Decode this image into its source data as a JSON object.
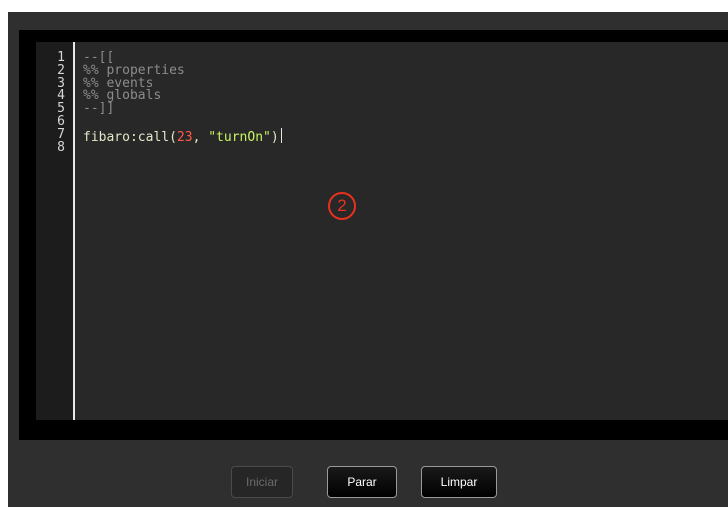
{
  "editor": {
    "lines": [
      {
        "num": "1",
        "tokens": [
          {
            "cls": "comment",
            "text": "--[["
          }
        ]
      },
      {
        "num": "2",
        "tokens": [
          {
            "cls": "comment",
            "text": "%% properties"
          }
        ]
      },
      {
        "num": "3",
        "tokens": [
          {
            "cls": "comment",
            "text": "%% events"
          }
        ]
      },
      {
        "num": "4",
        "tokens": [
          {
            "cls": "comment",
            "text": "%% globals"
          }
        ]
      },
      {
        "num": "5",
        "tokens": [
          {
            "cls": "comment",
            "text": "--]]"
          }
        ]
      },
      {
        "num": "6",
        "tokens": []
      },
      {
        "num": "7",
        "tokens": [
          {
            "cls": "ident",
            "text": "fibaro:call("
          },
          {
            "cls": "num",
            "text": "23"
          },
          {
            "cls": "punct",
            "text": ", "
          },
          {
            "cls": "str",
            "text": "\"turnOn\""
          },
          {
            "cls": "punct",
            "text": ")"
          }
        ]
      },
      {
        "num": "8",
        "tokens": []
      }
    ]
  },
  "annotation": {
    "label": "2",
    "color": "#e8321e"
  },
  "buttons": {
    "start_label": "Iniciar",
    "stop_label": "Parar",
    "clear_label": "Limpar"
  },
  "colors": {
    "comment": "#8c8c8c",
    "number": "#ff5a4a",
    "string": "#c8f560",
    "identifier": "#e6e6c8"
  }
}
